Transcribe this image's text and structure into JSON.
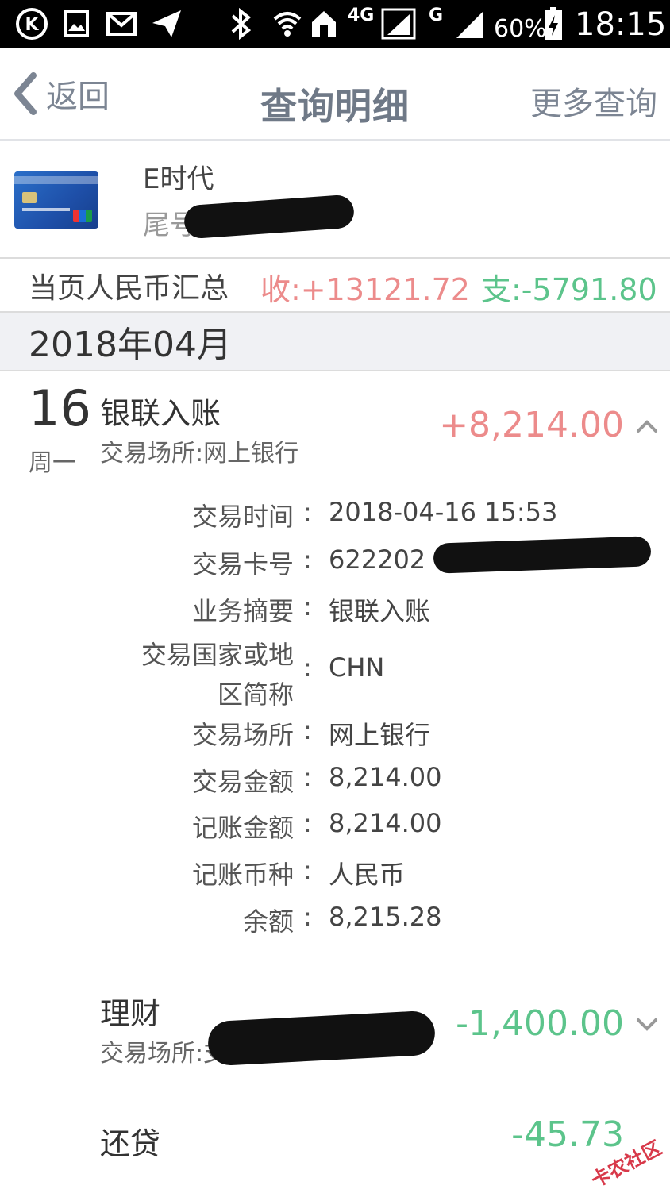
{
  "status_bar": {
    "network": "4G",
    "network2": "G",
    "battery": "60%",
    "time": "18:15"
  },
  "nav": {
    "back_label": "返回",
    "title": "查询明细",
    "more_label": "更多查询"
  },
  "card": {
    "name": "E时代",
    "tail_label": "尾号"
  },
  "summary": {
    "label": "当页人民币汇总",
    "income": "收:+13121.72",
    "expense": "支:-5791.80"
  },
  "month": "2018年04月",
  "transactions": [
    {
      "day": "16",
      "weekday": "周一",
      "title": "银联入账",
      "place": "交易场所:网上银行",
      "amount": "+8,214.00",
      "details": [
        {
          "label": "交易时间",
          "value": "2018-04-16 15:53"
        },
        {
          "label": "交易卡号",
          "value": "622202 16"
        },
        {
          "label": "业务摘要",
          "value": "银联入账"
        },
        {
          "label": "交易国家或地区简称",
          "value": "CHN"
        },
        {
          "label": "交易场所",
          "value": "网上银行"
        },
        {
          "label": "交易金额",
          "value": "8,214.00"
        },
        {
          "label": "记账金额",
          "value": "8,214.00"
        },
        {
          "label": "记账币种",
          "value": "人民币"
        },
        {
          "label": "余额",
          "value": "8,215.28"
        }
      ]
    },
    {
      "title": "理财",
      "place": "交易场所:支付",
      "amount": "-1,400.00"
    },
    {
      "title": "还贷",
      "amount": "-45.73"
    }
  ],
  "watermark": "卡农社区",
  "colors": {
    "income": "#ec8b8b",
    "expense": "#5cc48b",
    "nav_text": "#7c8593"
  }
}
